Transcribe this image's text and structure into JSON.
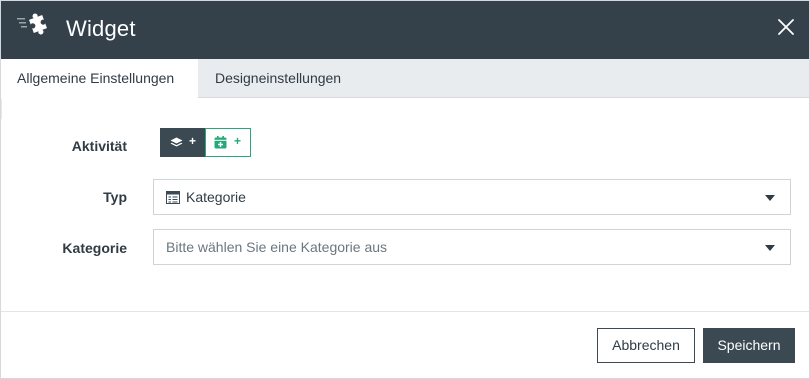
{
  "header": {
    "title": "Widget",
    "logo_icon": "puzzle-icon",
    "close_icon": "close-icon"
  },
  "tabs": [
    {
      "label": "Allgemeine Einstellungen",
      "active": true
    },
    {
      "label": "Designeinstellungen",
      "active": false
    }
  ],
  "form": {
    "activity": {
      "label": "Aktivität",
      "buttons": [
        {
          "icon": "layers-icon",
          "text": "+",
          "style": "dark"
        },
        {
          "icon": "calendar-plus-icon",
          "text": "+",
          "style": "outline-green"
        }
      ]
    },
    "type": {
      "label": "Typ",
      "value": "Kategorie",
      "icon": "category-table-icon"
    },
    "category": {
      "label": "Kategorie",
      "placeholder": "Bitte wählen Sie eine Kategorie aus"
    }
  },
  "footer": {
    "cancel_label": "Abbrechen",
    "save_label": "Speichern"
  },
  "colors": {
    "header_bg": "#34404a",
    "accent_green": "#27a87a",
    "dark_button": "#3b4953",
    "tab_bar_bg": "#e9ecee"
  }
}
